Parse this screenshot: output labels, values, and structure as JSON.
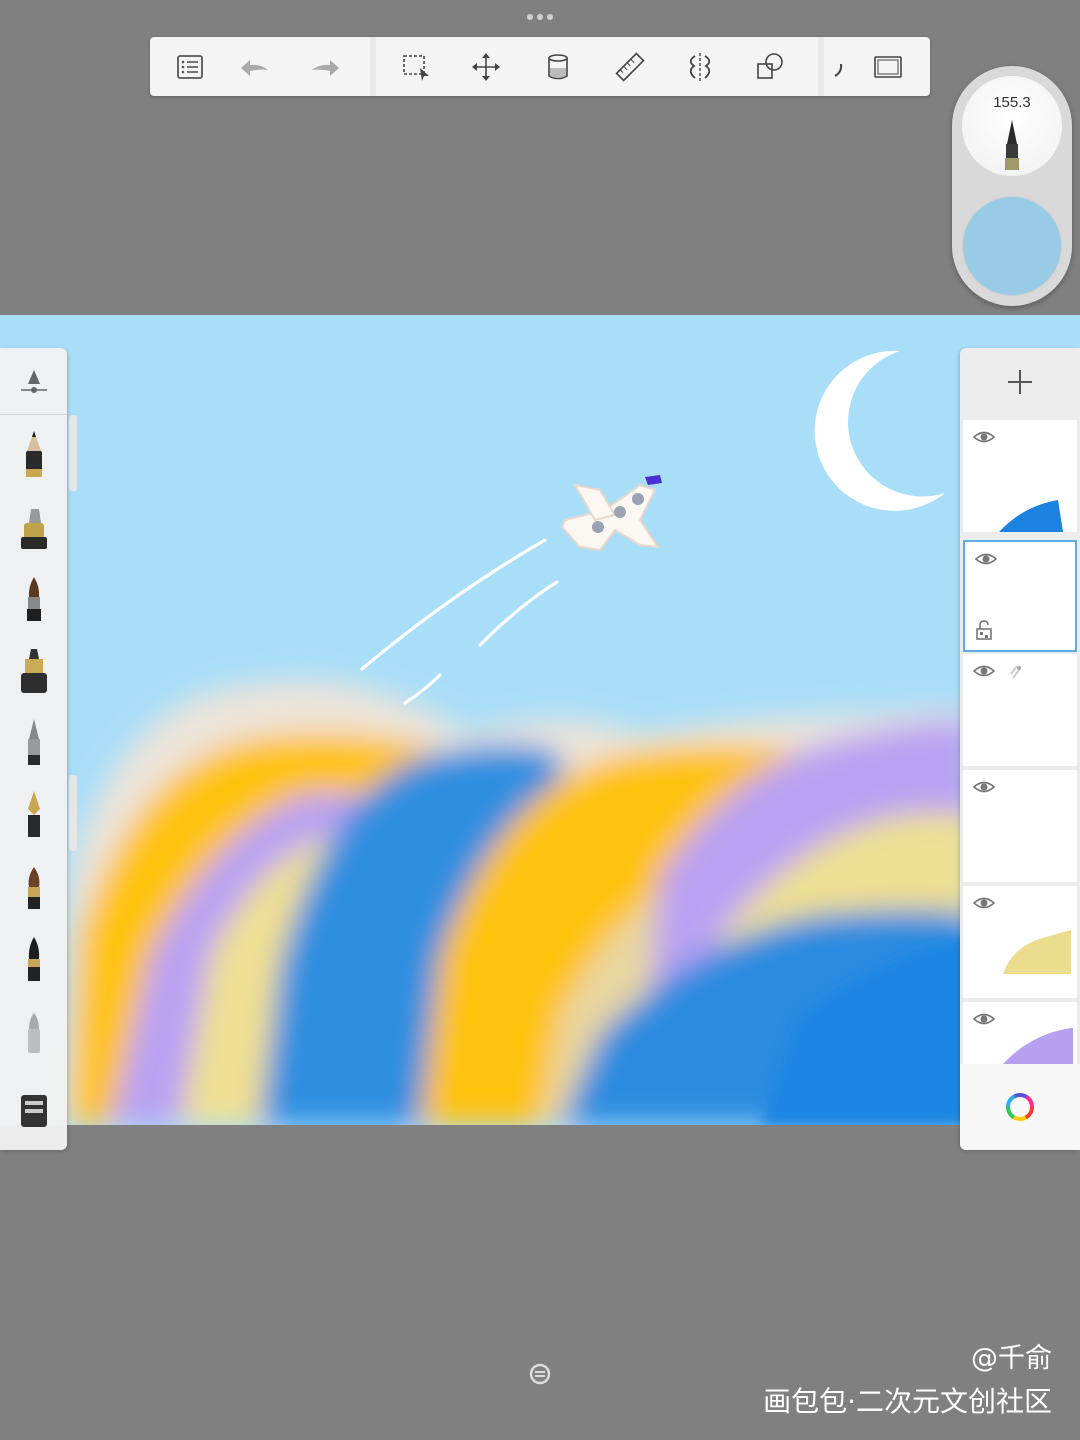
{
  "top_handle": {
    "icon": "more-dots-icon"
  },
  "toolbar": {
    "tools": [
      {
        "name": "gallery",
        "icon": "list-icon"
      },
      {
        "name": "undo",
        "icon": "undo-icon"
      },
      {
        "name": "redo",
        "icon": "redo-icon"
      },
      {
        "name": "select",
        "icon": "selection-icon"
      },
      {
        "name": "transform",
        "icon": "move-icon"
      },
      {
        "name": "fill",
        "icon": "paint-bucket-icon"
      },
      {
        "name": "ruler",
        "icon": "ruler-icon"
      },
      {
        "name": "symmetry",
        "icon": "symmetry-icon"
      },
      {
        "name": "shapes",
        "icon": "shapes-icon"
      },
      {
        "name": "curve",
        "icon": "curve-icon"
      },
      {
        "name": "fullscreen",
        "icon": "fullscreen-icon"
      }
    ]
  },
  "brush_puck": {
    "size_value": "155.3",
    "current_color": "#98CBE6"
  },
  "brush_palette": {
    "brushes": [
      "brush-properties",
      "pencil",
      "marker",
      "paintbrush",
      "airbrush",
      "ballpoint",
      "fountain-pen",
      "round-brush",
      "ink-brush",
      "eraser",
      "smudge"
    ]
  },
  "layers": {
    "add_icon": "plus-icon",
    "items": [
      {
        "name": "layer-blue",
        "visible": true,
        "selected": false,
        "locked": false
      },
      {
        "name": "layer-empty",
        "visible": true,
        "selected": true,
        "locked": true
      },
      {
        "name": "layer-plane",
        "visible": true,
        "selected": false,
        "locked": false
      },
      {
        "name": "layer-blank",
        "visible": true,
        "selected": false,
        "locked": false
      },
      {
        "name": "layer-yellow",
        "visible": true,
        "selected": false,
        "locked": false
      },
      {
        "name": "layer-purple",
        "visible": true,
        "selected": false,
        "locked": false
      }
    ],
    "color_wheel_icon": "color-wheel-icon"
  },
  "watermark": {
    "line1": "@千俞",
    "line2": "画包包·二次元文创社区"
  }
}
